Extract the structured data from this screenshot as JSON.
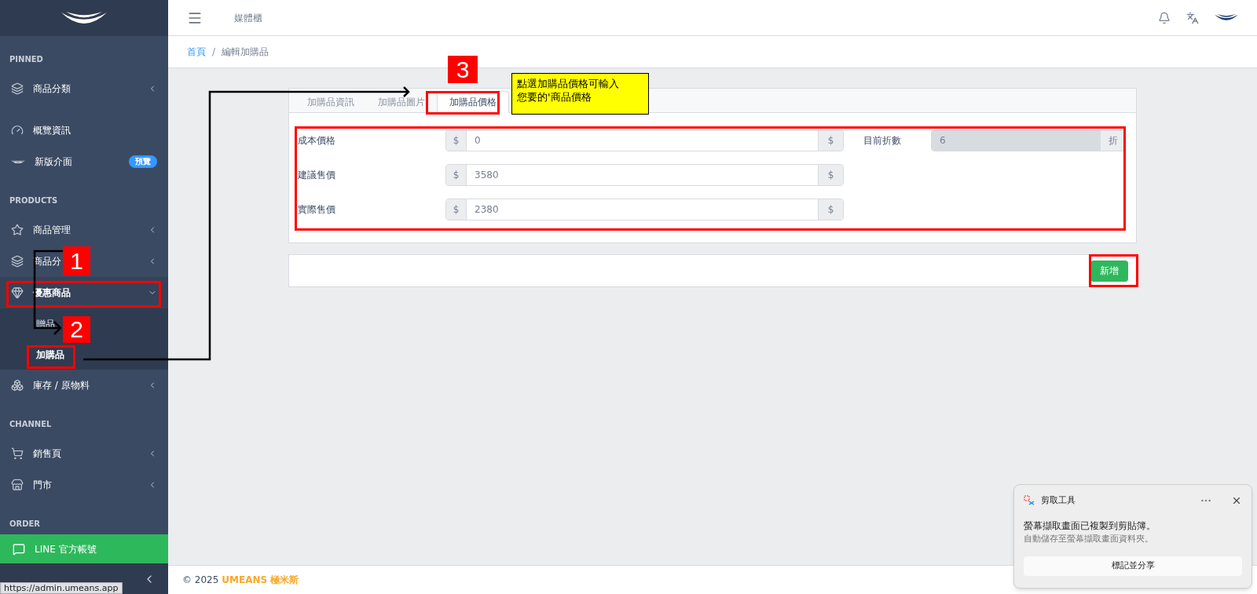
{
  "header": {
    "title": "媒體櫃"
  },
  "breadcrumb": [
    {
      "label": "首頁",
      "kind": "link"
    },
    {
      "label": "/",
      "kind": "separator"
    },
    {
      "label": "編輯加購品",
      "kind": "current"
    }
  ],
  "sidebar": {
    "sections": [
      {
        "heading": "PINNED",
        "items": [
          {
            "label": "商品分類",
            "kind": "layers",
            "expanded": false
          }
        ]
      },
      {
        "items": [
          {
            "label": "概覽資訊",
            "kind": "gauge"
          },
          {
            "label": "新版介面",
            "kind": "logo",
            "badge": "預覽"
          }
        ]
      },
      {
        "heading": "PRODUCTS",
        "items": [
          {
            "label": "商品管理",
            "kind": "star",
            "expanded": false
          },
          {
            "label": "商品分",
            "kind": "layers",
            "expanded": false
          },
          {
            "label": "優惠商品",
            "kind": "gem",
            "expanded": true,
            "children": [
              {
                "label": "贈品",
                "selected": false
              },
              {
                "label": "加購品",
                "selected": true
              }
            ]
          },
          {
            "label": "庫存 / 原物料",
            "kind": "boxes",
            "expanded": false
          }
        ]
      },
      {
        "heading": "CHANNEL",
        "items": [
          {
            "label": "銷售頁",
            "kind": "cart",
            "expanded": false
          },
          {
            "label": "門市",
            "kind": "store",
            "expanded": false
          }
        ]
      },
      {
        "heading": "ORDER"
      }
    ],
    "line_button": {
      "label": "LINE 官方帳號"
    },
    "link_preview": "https://admin.umeans.app"
  },
  "tabs": [
    {
      "label": "加購品資訊",
      "selected": false
    },
    {
      "label": "加購品圖片",
      "selected": false
    },
    {
      "label": "加購品價格",
      "selected": true
    }
  ],
  "fields_left": [
    {
      "label": "成本價格",
      "prefix": "$",
      "value": "0",
      "suffix": "$",
      "disabled": false
    },
    {
      "label": "建議售價",
      "prefix": "$",
      "value": "3580",
      "suffix": "$",
      "disabled": false
    },
    {
      "label": "實際售價",
      "prefix": "$",
      "value": "2380",
      "suffix": "$",
      "disabled": false
    }
  ],
  "fields_right": [
    {
      "label": "目前折數",
      "value": "6",
      "suffix": "折",
      "disabled": true
    }
  ],
  "submit": {
    "label": "新增"
  },
  "footer": {
    "copyright": "© 2025",
    "brand": "UMEANS 極米斯"
  },
  "toast": {
    "app": "剪取工具",
    "message": "螢幕擷取畫面已複製到剪貼簿。",
    "detail": "自動儲存至螢幕擷取畫面資料夾。",
    "action": "標記並分享"
  },
  "annotations": {
    "steps": [
      "1",
      "2",
      "3"
    ],
    "callout": [
      "點選加購品價格可輸入",
      "您要的'商品價格"
    ]
  }
}
